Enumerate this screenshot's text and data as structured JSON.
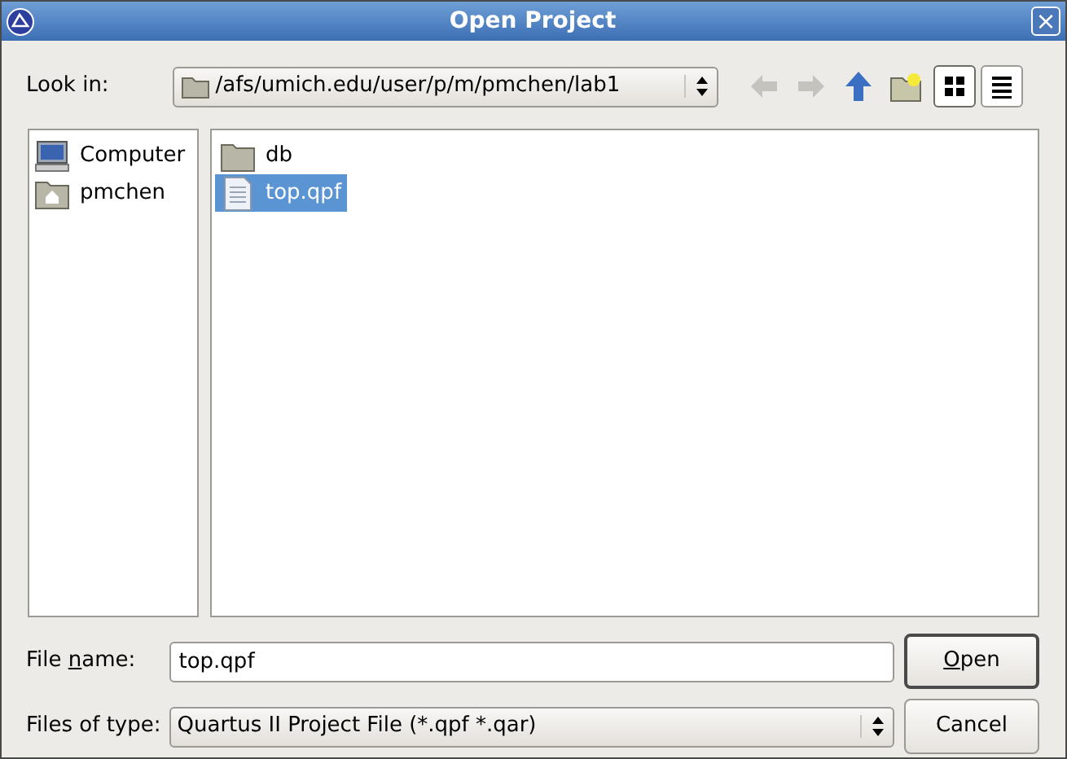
{
  "window": {
    "title": "Open Project",
    "close": "×"
  },
  "look_in": {
    "label": "Look in:",
    "path": "/afs/umich.edu/user/p/m/pmchen/lab1"
  },
  "toolbar": [
    {
      "kind": "back",
      "disabled": true
    },
    {
      "kind": "forward",
      "disabled": true
    },
    {
      "kind": "up",
      "disabled": false
    },
    {
      "kind": "new-folder",
      "disabled": false
    },
    {
      "kind": "icon-view",
      "selected": true
    },
    {
      "kind": "list-view",
      "selected": false
    }
  ],
  "places": [
    {
      "kind": "computer",
      "label": "Computer"
    },
    {
      "kind": "home",
      "label": "pmchen"
    }
  ],
  "files": [
    {
      "kind": "folder",
      "name": "db",
      "selected": false
    },
    {
      "kind": "file",
      "name": "top.qpf",
      "selected": true
    }
  ],
  "file_name": {
    "label": {
      "before": "File ",
      "key": "n",
      "after": "ame:"
    },
    "value": "top.qpf"
  },
  "file_type": {
    "label": "Files of type:",
    "value": "Quartus II Project File (*.qpf *.qar)"
  },
  "buttons": [
    {
      "label": {
        "key": "O",
        "after": "pen"
      },
      "default": true
    },
    {
      "label": {
        "before": "Cancel"
      },
      "default": false
    }
  ]
}
